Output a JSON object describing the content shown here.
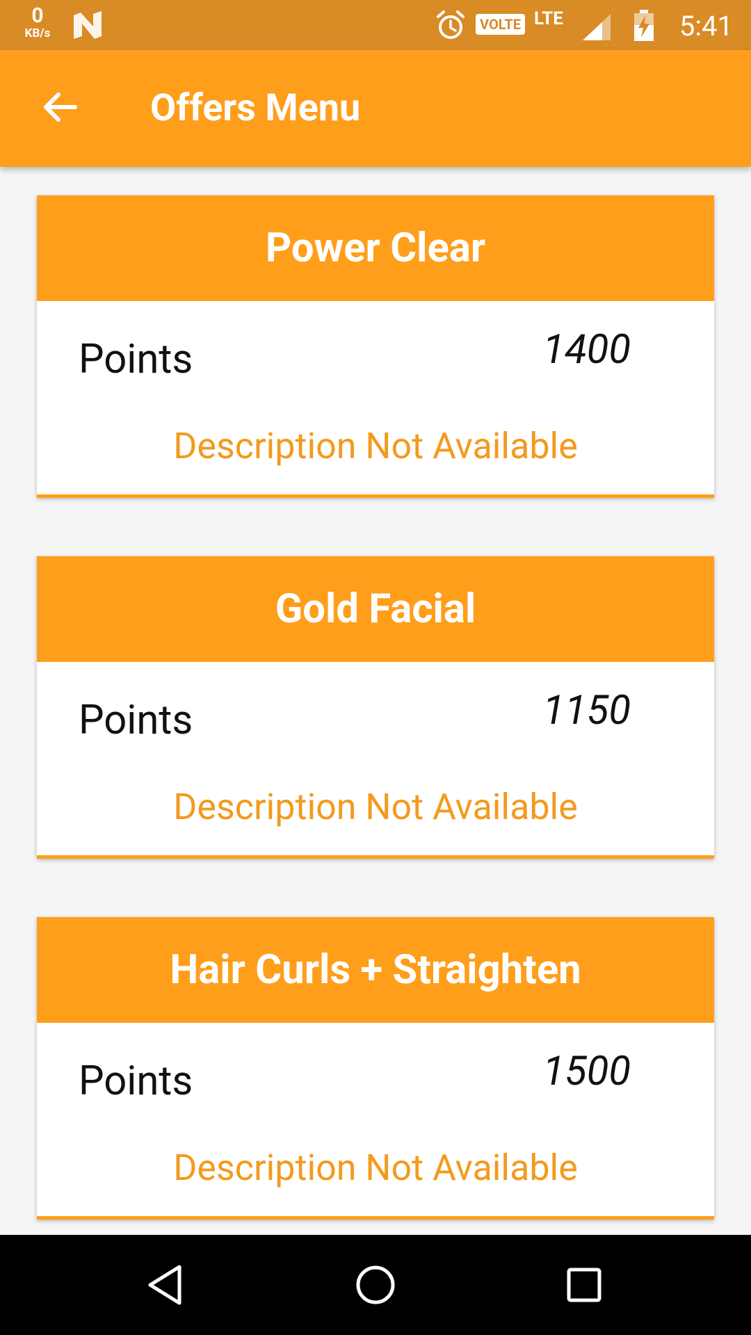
{
  "status_bar": {
    "net_speed_value": "0",
    "net_speed_unit": "KB/s",
    "network_badge": "VOLTE",
    "network_type": "LTE",
    "time": "5:41",
    "icons": [
      "n-notification-icon",
      "alarm-icon",
      "signal-icon",
      "battery-charging-icon"
    ]
  },
  "app_bar": {
    "title": "Offers Menu",
    "back_icon": "arrow-back-icon"
  },
  "offers": [
    {
      "name": "Power Clear",
      "points_label": "Points",
      "points": "1400",
      "description": "Description Not Available"
    },
    {
      "name": "Gold Facial",
      "points_label": "Points",
      "points": "1150",
      "description": "Description Not Available"
    },
    {
      "name": "Hair Curls + Straighten",
      "points_label": "Points",
      "points": "1500",
      "description": "Description Not Available"
    }
  ],
  "nav_bar": {
    "icons": [
      "back-triangle-icon",
      "home-circle-icon",
      "recents-square-icon"
    ]
  },
  "colors": {
    "status_bar": "#D98B26",
    "primary": "#FF9E1B",
    "description_text": "#F39A1E",
    "background": "#F5F5F5"
  }
}
